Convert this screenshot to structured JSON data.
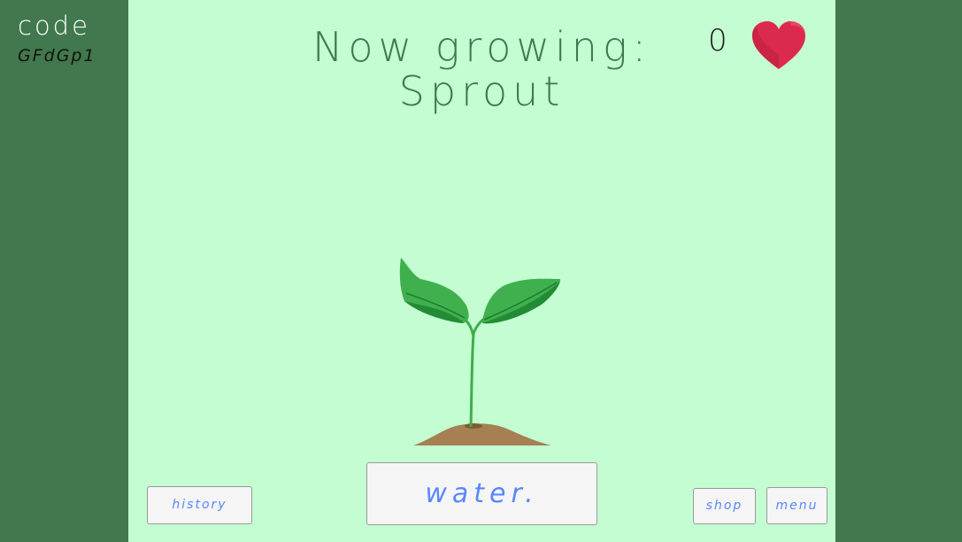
{
  "sidebar": {
    "code_label": "code",
    "code_value": "GFdGp1"
  },
  "header": {
    "title_line1": "Now growing:",
    "title_line2": "Sprout"
  },
  "hearts": {
    "count": "0",
    "icon": "heart-icon",
    "color": "#dc2a4d"
  },
  "plant": {
    "name": "Sprout",
    "icon": "sprout-icon"
  },
  "buttons": {
    "history": "history",
    "water": "water.",
    "shop": "shop",
    "menu": "menu"
  },
  "colors": {
    "background": "#41784d",
    "stage": "#c3fdd1",
    "button_text": "#5a86ff",
    "button_bg": "#f5f5f5"
  }
}
